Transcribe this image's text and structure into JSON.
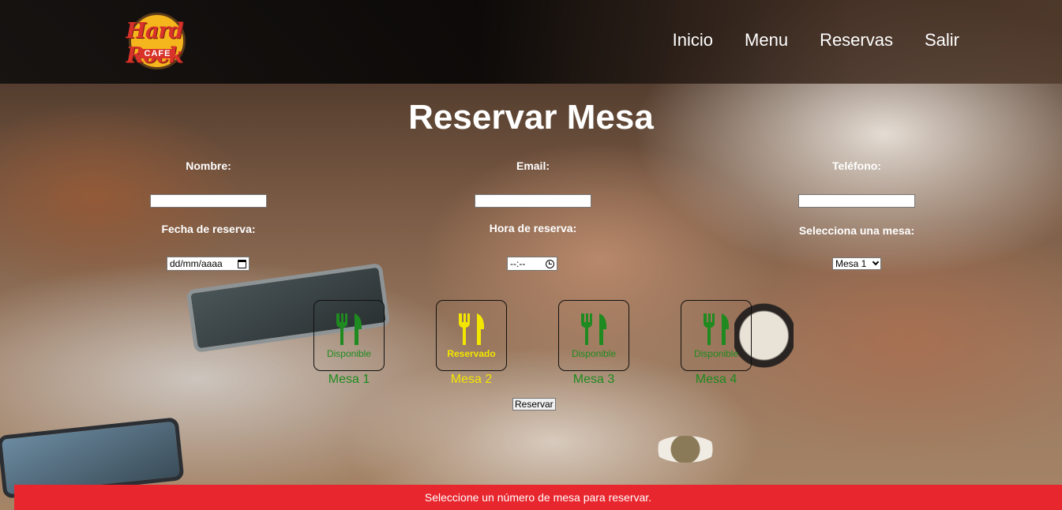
{
  "brand": {
    "name": "Hard Rock",
    "sub": "CAFE"
  },
  "nav": {
    "items": [
      "Inicio",
      "Menu",
      "Reservas",
      "Salir"
    ]
  },
  "page_title": "Reservar Mesa",
  "form": {
    "nombre_label": "Nombre:",
    "nombre_value": "",
    "email_label": "Email:",
    "email_value": "",
    "telefono_label": "Teléfono:",
    "telefono_value": "",
    "fecha_label": "Fecha de reserva:",
    "fecha_placeholder": "dd/mm/aaaa",
    "hora_label": "Hora de reserva:",
    "hora_placeholder": "--:--",
    "mesa_label": "Selecciona una mesa:",
    "mesa_selected": "Mesa 1"
  },
  "mesas": [
    {
      "name": "Mesa 1",
      "status": "Disponible",
      "color": "#1f8a1f"
    },
    {
      "name": "Mesa 2",
      "status": "Reservado",
      "color": "#f3e600"
    },
    {
      "name": "Mesa 3",
      "status": "Disponible",
      "color": "#1f8a1f"
    },
    {
      "name": "Mesa 4",
      "status": "Disponible",
      "color": "#1f8a1f"
    }
  ],
  "reservar_label": "Reservar",
  "alert": {
    "text": "Seleccione un número de mesa para reservar.",
    "color": "#e8262e"
  }
}
